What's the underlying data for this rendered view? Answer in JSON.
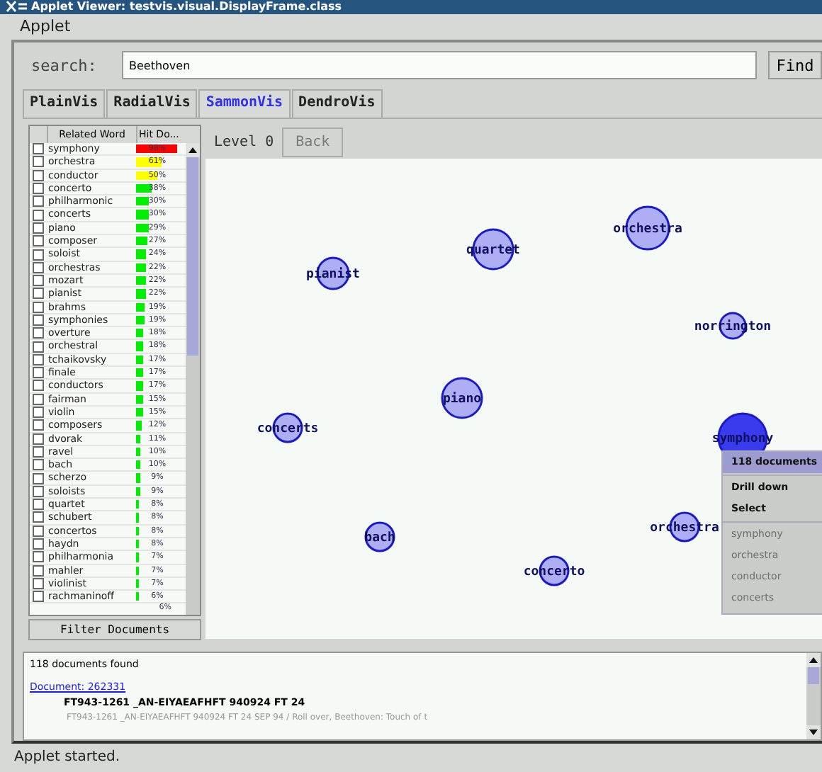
{
  "window": {
    "title": "Applet Viewer: testvis.visual.DisplayFrame.class"
  },
  "menu": [
    "Applet"
  ],
  "search": {
    "label": "search:",
    "value": "Beethoven",
    "button": "Find"
  },
  "tabs": [
    {
      "label": "PlainVis",
      "selected": false
    },
    {
      "label": "RadialVis",
      "selected": false
    },
    {
      "label": "SammonVis",
      "selected": true
    },
    {
      "label": "DendroVis",
      "selected": false
    }
  ],
  "word_list": {
    "columns": [
      "Related Word",
      "Hit Do..."
    ],
    "rows": [
      {
        "word": "symphony",
        "hits": "98%",
        "color": "#ff0000",
        "checked": false
      },
      {
        "word": "orchestra",
        "hits": "61%",
        "color": "#ffff00",
        "checked": false
      },
      {
        "word": "conductor",
        "hits": "50%",
        "color": "#ffff00",
        "checked": false
      },
      {
        "word": "concerto",
        "hits": "38%",
        "color": "#00ee00",
        "checked": false
      },
      {
        "word": "philharmonic",
        "hits": "30%",
        "color": "#00ee00",
        "checked": false
      },
      {
        "word": "concerts",
        "hits": "30%",
        "color": "#00ee00",
        "checked": false
      },
      {
        "word": "piano",
        "hits": "29%",
        "color": "#00ee00",
        "checked": false
      },
      {
        "word": "composer",
        "hits": "27%",
        "color": "#00ee00",
        "checked": false
      },
      {
        "word": "soloist",
        "hits": "24%",
        "color": "#00ee00",
        "checked": false
      },
      {
        "word": "orchestras",
        "hits": "22%",
        "color": "#00ee00",
        "checked": false
      },
      {
        "word": "mozart",
        "hits": "22%",
        "color": "#00ee00",
        "checked": false
      },
      {
        "word": "pianist",
        "hits": "22%",
        "color": "#00ee00",
        "checked": false
      },
      {
        "word": "brahms",
        "hits": "19%",
        "color": "#00ee00",
        "checked": false
      },
      {
        "word": "symphonies",
        "hits": "19%",
        "color": "#00ee00",
        "checked": false
      },
      {
        "word": "overture",
        "hits": "18%",
        "color": "#00ee00",
        "checked": false
      },
      {
        "word": "orchestral",
        "hits": "18%",
        "color": "#00ee00",
        "checked": false
      },
      {
        "word": "tchaikovsky",
        "hits": "17%",
        "color": "#00ee00",
        "checked": false
      },
      {
        "word": "finale",
        "hits": "17%",
        "color": "#00ee00",
        "checked": false
      },
      {
        "word": "conductors",
        "hits": "17%",
        "color": "#00ee00",
        "checked": false
      },
      {
        "word": "fairman",
        "hits": "15%",
        "color": "#00ee00",
        "checked": false
      },
      {
        "word": "violin",
        "hits": "15%",
        "color": "#00ee00",
        "checked": false
      },
      {
        "word": "composers",
        "hits": "12%",
        "color": "#00ee00",
        "checked": false
      },
      {
        "word": "dvorak",
        "hits": "11%",
        "color": "#00ee00",
        "checked": false
      },
      {
        "word": "ravel",
        "hits": "10%",
        "color": "#00ee00",
        "checked": false
      },
      {
        "word": "bach",
        "hits": "10%",
        "color": "#00ee00",
        "checked": false
      },
      {
        "word": "scherzo",
        "hits": "9%",
        "color": "#00ee00",
        "checked": false
      },
      {
        "word": "soloists",
        "hits": "9%",
        "color": "#00ee00",
        "checked": false
      },
      {
        "word": "quartet",
        "hits": "8%",
        "color": "#00ee00",
        "checked": false
      },
      {
        "word": "schubert",
        "hits": "8%",
        "color": "#00ee00",
        "checked": false
      },
      {
        "word": "concertos",
        "hits": "8%",
        "color": "#00ee00",
        "checked": false
      },
      {
        "word": "haydn",
        "hits": "8%",
        "color": "#00ee00",
        "checked": false
      },
      {
        "word": "philharmonia",
        "hits": "7%",
        "color": "#00ee00",
        "checked": false
      },
      {
        "word": "mahler",
        "hits": "7%",
        "color": "#00ee00",
        "checked": false
      },
      {
        "word": "violinist",
        "hits": "7%",
        "color": "#00ee00",
        "checked": false
      },
      {
        "word": "rachmaninoff",
        "hits": "6%",
        "color": "#00ee00",
        "checked": false
      }
    ],
    "partial_hits": "6%",
    "filter_button": "Filter Documents"
  },
  "toolbar": {
    "level_label": "Level 0",
    "back_button": "Back",
    "back_disabled": true
  },
  "map_nodes": [
    {
      "label": "pianist",
      "selected": false
    },
    {
      "label": "quartet",
      "selected": false
    },
    {
      "label": "orchestra",
      "selected": false
    },
    {
      "label": "norrington",
      "selected": false
    },
    {
      "label": "piano",
      "selected": false
    },
    {
      "label": "concerts",
      "selected": false
    },
    {
      "label": "symphony",
      "selected": true
    },
    {
      "label": "orchestra",
      "selected": false
    },
    {
      "label": "bach",
      "selected": false
    },
    {
      "label": "concerto",
      "selected": false
    }
  ],
  "context_menu": [
    {
      "label": "118 documents",
      "selected": true,
      "disabled": false
    },
    {
      "label": "Drill down",
      "selected": false,
      "disabled": false
    },
    {
      "label": "Select",
      "selected": false,
      "disabled": false
    },
    {
      "label": "symphony",
      "selected": false,
      "disabled": true
    },
    {
      "label": "orchestra",
      "selected": false,
      "disabled": true
    },
    {
      "label": "conductor",
      "selected": false,
      "disabled": true
    },
    {
      "label": "concerts",
      "selected": false,
      "disabled": true
    }
  ],
  "results": {
    "summary": "118 documents found",
    "link": "Document: 262331",
    "heading": "FT943-1261 _AN-EIYAEAFHFT 940924 FT 24",
    "snippet": "FT943-1261 _AN-EIYAEAFHFT 940924 FT 24 SEP 94 / Roll over, Beethoven: Touch of t"
  },
  "status_bar": "Applet started."
}
